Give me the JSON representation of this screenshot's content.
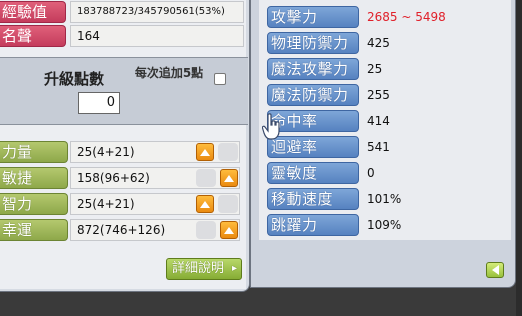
{
  "left": {
    "exp": {
      "label": "經驗值",
      "value": "183788723/345790561(53%)"
    },
    "fame": {
      "label": "名聲",
      "value": "164"
    },
    "ap": {
      "label": "升級點數",
      "value": "0",
      "auto_label": "每次追加5點"
    },
    "stats": [
      {
        "label": "力量",
        "value": "25(4+21)",
        "up_enabled": true
      },
      {
        "label": "敏捷",
        "value": "158(96+62)",
        "up_enabled": true
      },
      {
        "label": "智力",
        "value": "25(4+21)",
        "up_enabled": true
      },
      {
        "label": "幸運",
        "value": "872(746+126)",
        "up_enabled": true
      }
    ],
    "detail_button": "詳細說明",
    "detail_arrow": "▸"
  },
  "right": {
    "stats": [
      {
        "label": "攻擊力",
        "value": "2685 ~ 5498",
        "highlight": true
      },
      {
        "label": "物理防禦力",
        "value": "425"
      },
      {
        "label": "魔法攻擊力",
        "value": "25"
      },
      {
        "label": "魔法防禦力",
        "value": "255"
      },
      {
        "label": "命中率",
        "value": "414"
      },
      {
        "label": "迴避率",
        "value": "541"
      },
      {
        "label": "靈敏度",
        "value": "0"
      },
      {
        "label": "移動速度",
        "value": "101%"
      },
      {
        "label": "跳躍力",
        "value": "109%"
      }
    ]
  },
  "colors": {
    "attack_value": "#e0202a",
    "label_red": "#c43c5c",
    "label_green": "#8ea84a",
    "label_blue": "#5682c0",
    "up_button": "#ea8a10"
  },
  "icons": {
    "up": "up-arrow-icon",
    "back": "back-arrow-icon",
    "cursor": "hand-pointer-icon"
  }
}
